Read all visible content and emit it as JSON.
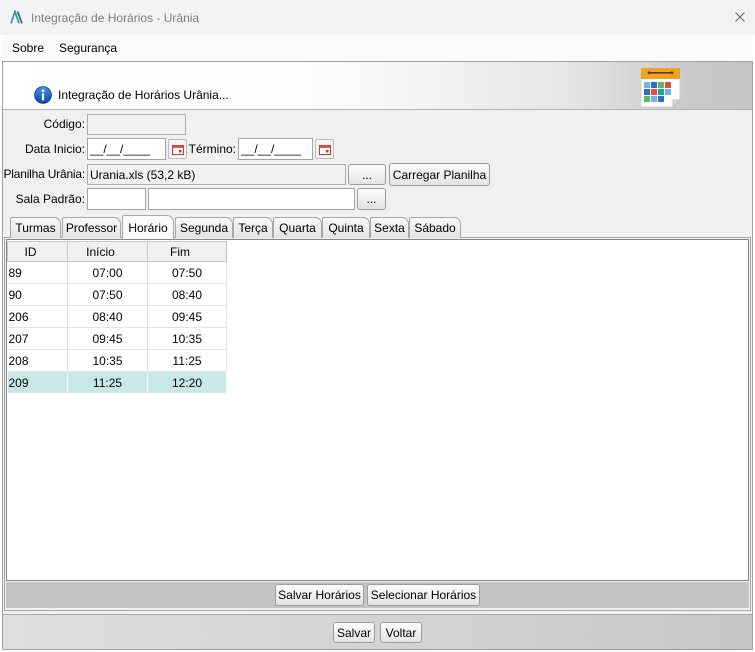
{
  "window": {
    "title": "Integração de Horários - Urânia",
    "app_icon": "app-logo-icon",
    "close_icon": "close-icon"
  },
  "menu": {
    "items": [
      {
        "label": "Sobre"
      },
      {
        "label": "Segurança"
      }
    ]
  },
  "header": {
    "title": "Integração de Horários Urânia...",
    "info_icon": "info-icon",
    "logo_icon": "schedule-grid-icon"
  },
  "form": {
    "codigo": {
      "label": "Código:",
      "value": ""
    },
    "data_inicio": {
      "label": "Data Inicio:",
      "value": "__/__/____",
      "picker_icon": "calendar-icon"
    },
    "termino": {
      "label": "Término:",
      "value": "__/__/____",
      "picker_icon": "calendar-icon"
    },
    "planilha": {
      "label": "Planilha Urânia:",
      "value": "Urania.xls (53,2 kB)",
      "browse_label": "...",
      "load_label": "Carregar Planilha"
    },
    "sala_padrao": {
      "label": "Sala Padrão:",
      "code_value": "",
      "name_value": "",
      "browse_label": "..."
    }
  },
  "tabs": [
    {
      "label": "Turmas",
      "active": false
    },
    {
      "label": "Professor",
      "active": false
    },
    {
      "label": "Horário",
      "active": true
    },
    {
      "label": "Segunda",
      "active": false
    },
    {
      "label": "Terça",
      "active": false
    },
    {
      "label": "Quarta",
      "active": false
    },
    {
      "label": "Quinta",
      "active": false
    },
    {
      "label": "Sexta",
      "active": false
    },
    {
      "label": "Sábado",
      "active": false
    }
  ],
  "table": {
    "columns": [
      "ID",
      "Início",
      "Fim"
    ],
    "rows": [
      {
        "id": "89",
        "inicio": "07:00",
        "fim": "07:50",
        "selected": false
      },
      {
        "id": "90",
        "inicio": "07:50",
        "fim": "08:40",
        "selected": false
      },
      {
        "id": "206",
        "inicio": "08:40",
        "fim": "09:45",
        "selected": false
      },
      {
        "id": "207",
        "inicio": "09:45",
        "fim": "10:35",
        "selected": false
      },
      {
        "id": "208",
        "inicio": "10:35",
        "fim": "11:25",
        "selected": false
      },
      {
        "id": "209",
        "inicio": "11:25",
        "fim": "12:20",
        "selected": true
      }
    ]
  },
  "panel_actions": {
    "save_label": "Salvar Horários",
    "select_label": "Selecionar Horários"
  },
  "footer": {
    "save_label": "Salvar",
    "back_label": "Voltar"
  },
  "colors": {
    "window_bg": "#f0f0f0",
    "selected_row": "#c8e7e7",
    "title_text": "#7d7d7d",
    "header_gradient_end": "#c6c6c6",
    "app_logo": "#2a9d8f"
  }
}
